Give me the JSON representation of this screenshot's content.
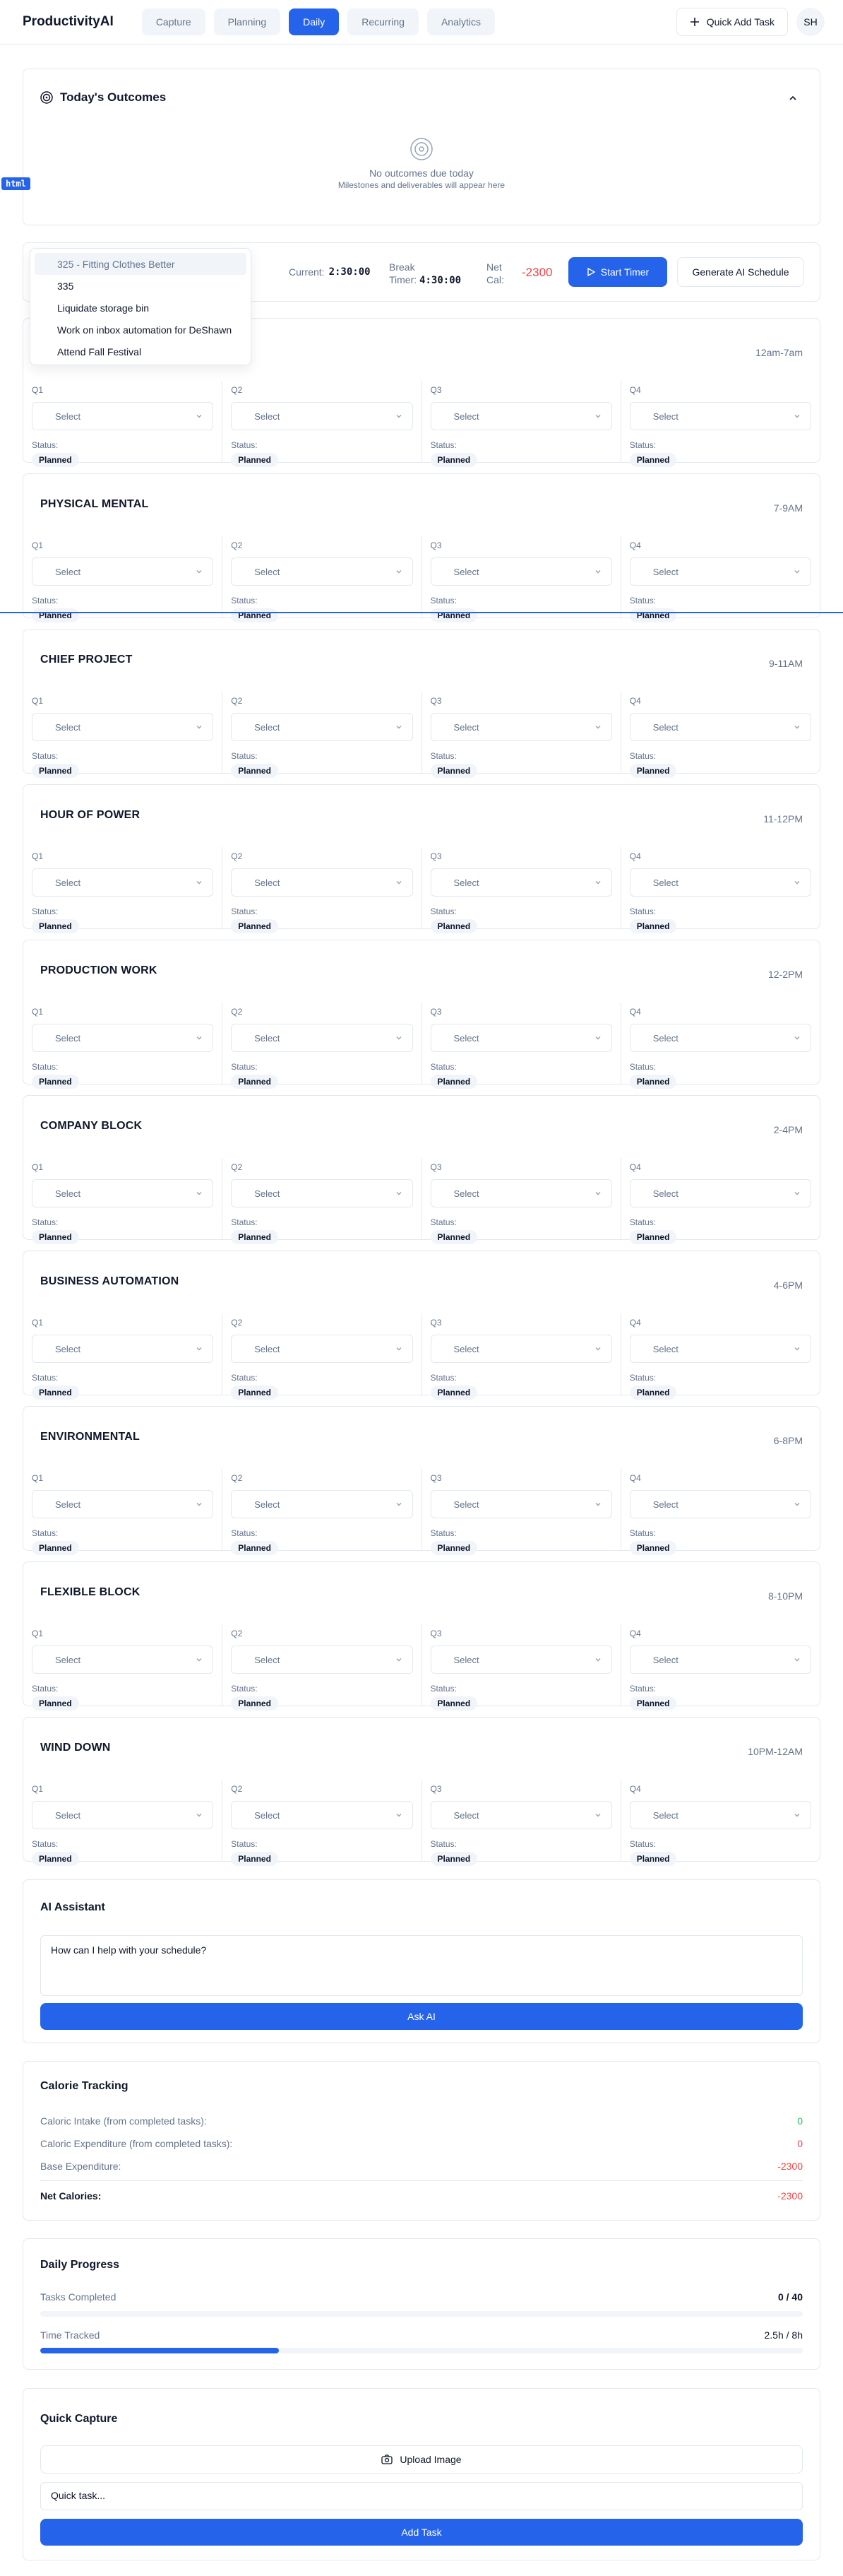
{
  "app": {
    "title": "ProductivityAI"
  },
  "nav": {
    "tabs": [
      {
        "label": "Capture",
        "active": false
      },
      {
        "label": "Planning",
        "active": false
      },
      {
        "label": "Daily",
        "active": true
      },
      {
        "label": "Recurring",
        "active": false
      },
      {
        "label": "Analytics",
        "active": false
      }
    ]
  },
  "header": {
    "quick_add_label": "Quick Add Task",
    "user_initials": "SH"
  },
  "outcomes": {
    "title": "Today's Outcomes",
    "empty_title": "No outcomes due today",
    "empty_subtitle": "Milestones and deliverables will appear here"
  },
  "timer": {
    "current_label": "Current:",
    "current_value": "2:30:00",
    "break_label_1": "Break",
    "break_label_2": "Timer:",
    "break_value": "4:30:00",
    "net_label_1": "Net",
    "net_label_2": "Cal:",
    "net_value": "-2300",
    "start_label": "Start Timer",
    "generate_label": "Generate AI Schedule"
  },
  "dropdown": {
    "items": [
      "325 - Fitting Clothes Better",
      "335",
      "Liquidate storage bin",
      "Work on inbox automation for DeShawn",
      "Attend Fall Festival"
    ]
  },
  "overlay": {
    "tag": "html"
  },
  "quarter_labels": [
    "Q1",
    "Q2",
    "Q3",
    "Q4"
  ],
  "select_placeholder": "Select",
  "status_label": "Status:",
  "status_value": "Planned",
  "blocks": [
    {
      "title": "",
      "time": "12am-7am"
    },
    {
      "title": "PHYSICAL MENTAL",
      "time": "7-9AM"
    },
    {
      "title": "CHIEF PROJECT",
      "time": "9-11AM"
    },
    {
      "title": "HOUR OF POWER",
      "time": "11-12PM"
    },
    {
      "title": "PRODUCTION WORK",
      "time": "12-2PM"
    },
    {
      "title": "COMPANY BLOCK",
      "time": "2-4PM"
    },
    {
      "title": "BUSINESS AUTOMATION",
      "time": "4-6PM"
    },
    {
      "title": "ENVIRONMENTAL",
      "time": "6-8PM"
    },
    {
      "title": "FLEXIBLE BLOCK",
      "time": "8-10PM"
    },
    {
      "title": "WIND DOWN",
      "time": "10PM-12AM"
    }
  ],
  "assistant": {
    "title": "AI Assistant",
    "placeholder": "How can I help with your schedule?",
    "button": "Ask AI"
  },
  "calories": {
    "title": "Calorie Tracking",
    "intake_label": "Caloric Intake (from completed tasks):",
    "intake_value": "0",
    "expend_label": "Caloric Expenditure (from completed tasks):",
    "expend_value": "0",
    "base_label": "Base Expenditure:",
    "base_value": "-2300",
    "net_label": "Net Calories:",
    "net_value": "-2300"
  },
  "progress": {
    "title": "Daily Progress",
    "tasks_label": "Tasks Completed",
    "tasks_value": "0 / 40",
    "tasks_fraction": 0,
    "time_label": "Time Tracked",
    "time_value": "2.5h / 8h",
    "time_fraction": 0.3125
  },
  "capture": {
    "title": "Quick Capture",
    "upload_label": "Upload Image",
    "task_placeholder": "Quick task...",
    "add_label": "Add Task"
  },
  "colors": {
    "accent": "#2563eb",
    "negative": "#ef4444",
    "positive": "#22c55e"
  }
}
